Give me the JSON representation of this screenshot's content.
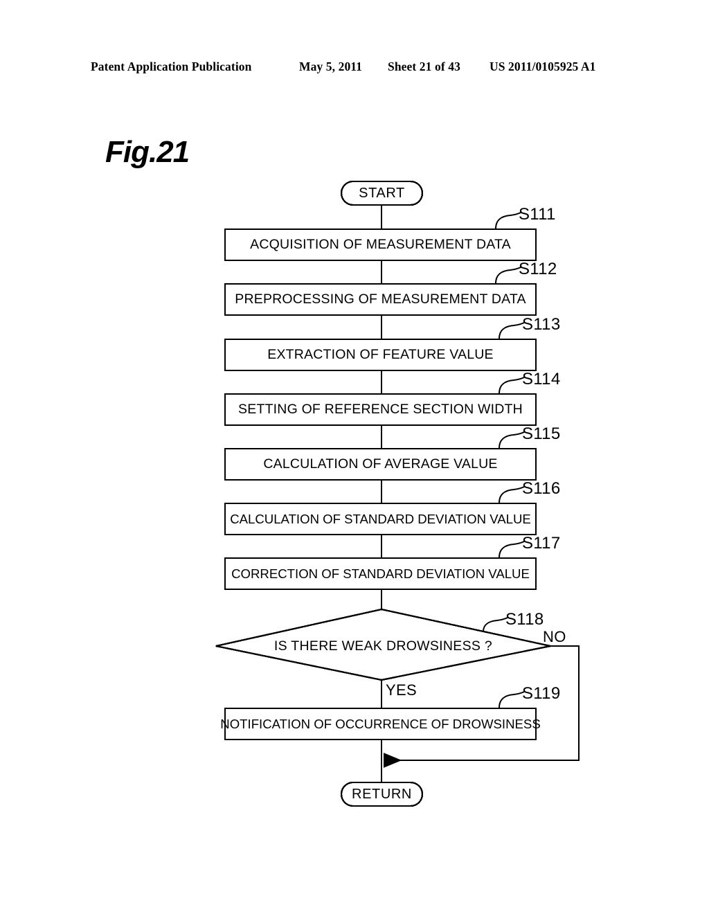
{
  "header": {
    "publication": "Patent Application Publication",
    "date": "May 5, 2011",
    "sheet": "Sheet 21 of 43",
    "doc_number": "US 2011/0105925 A1"
  },
  "figure": {
    "label": "Fig.21"
  },
  "flowchart": {
    "start_label": "START",
    "return_label": "RETURN",
    "steps": [
      {
        "id": "S111",
        "text": "ACQUISITION OF MEASUREMENT DATA"
      },
      {
        "id": "S112",
        "text": "PREPROCESSING OF MEASUREMENT DATA"
      },
      {
        "id": "S113",
        "text": "EXTRACTION OF FEATURE VALUE"
      },
      {
        "id": "S114",
        "text": "SETTING OF REFERENCE SECTION WIDTH"
      },
      {
        "id": "S115",
        "text": "CALCULATION OF AVERAGE VALUE"
      },
      {
        "id": "S116",
        "text": "CALCULATION OF STANDARD DEVIATION VALUE"
      },
      {
        "id": "S117",
        "text": "CORRECTION OF STANDARD DEVIATION VALUE"
      }
    ],
    "decision": {
      "id": "S118",
      "text": "IS THERE WEAK DROWSINESS ?",
      "yes_label": "YES",
      "no_label": "NO"
    },
    "final_step": {
      "id": "S119",
      "text": "NOTIFICATION OF OCCURRENCE OF DROWSINESS"
    }
  }
}
